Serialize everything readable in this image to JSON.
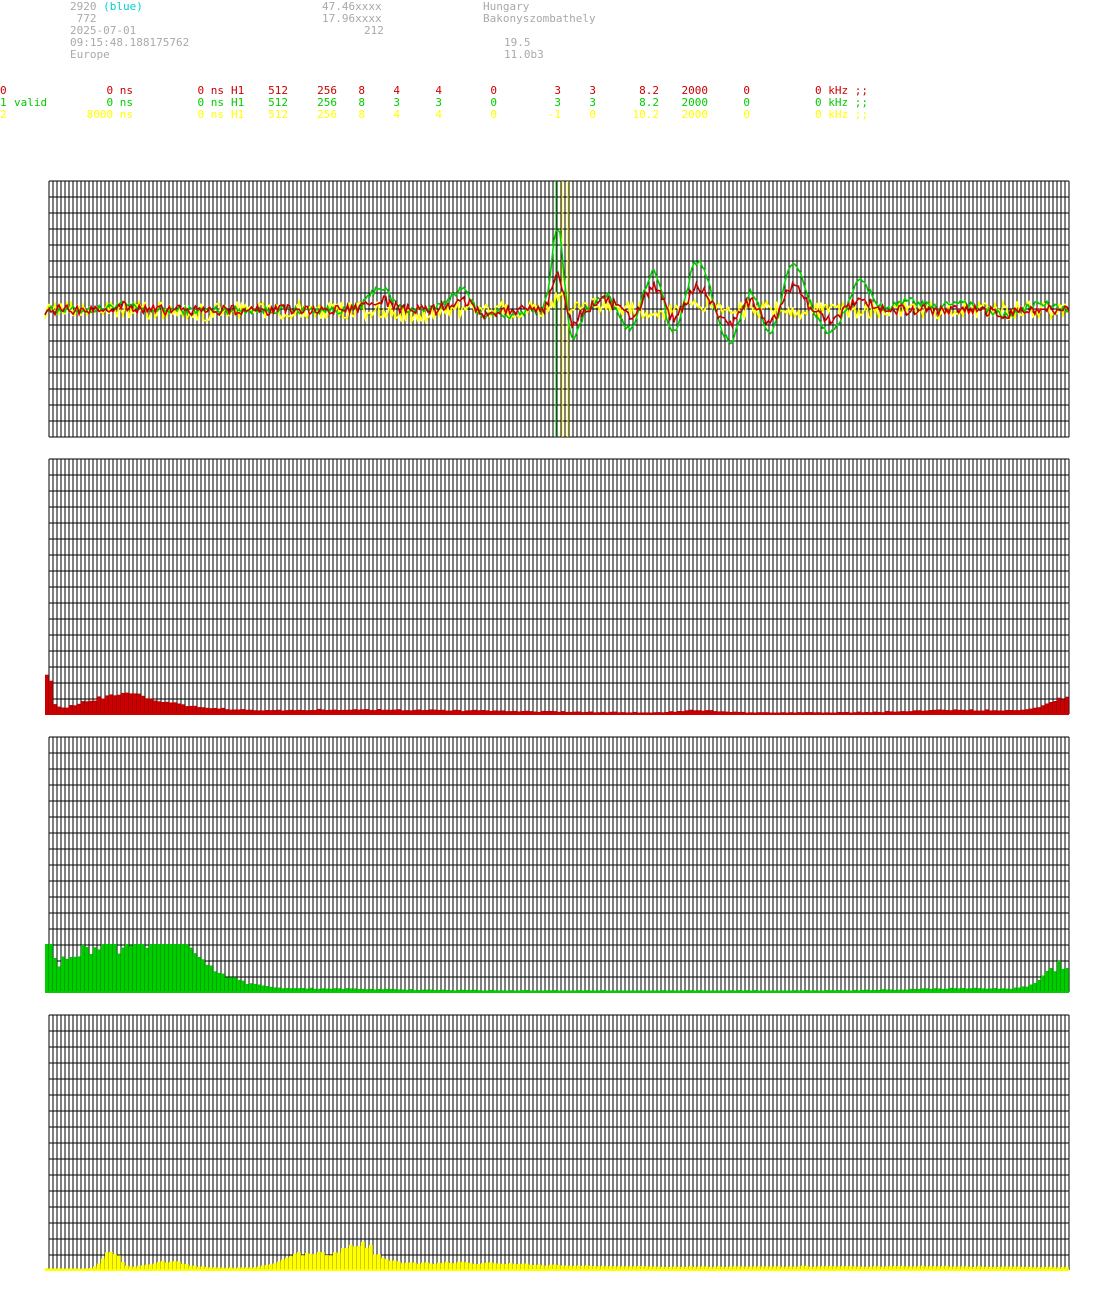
{
  "header": {
    "col1": [
      "2920",
      " 772",
      "2025-07-01",
      "09:15:48.188175762",
      "Europe"
    ],
    "col1_tag": "(blue)",
    "col2": [
      "47.46xxxx",
      "17.96xxxx",
      "212"
    ],
    "col3": [
      "Hungary",
      "Bakonyszombathely"
    ],
    "col4": [
      "19.5",
      "11.0b3"
    ]
  },
  "colors": {
    "ch0": "#cc0000",
    "ch1": "#00cc00",
    "ch2": "#ffff00",
    "grid": "#000000",
    "muted": "#a9a9a9",
    "tag": "#00d0d0"
  },
  "channels": [
    {
      "id": "0",
      "label": "",
      "delay": "0 ns",
      "offset": "0 ns",
      "filter": "H1",
      "n1": "512",
      "n2": "256",
      "n3": "8",
      "n4": "4",
      "n5": "4",
      "n6": "0",
      "n7": "3",
      "n8": "3",
      "n9": "8.2",
      "n10": "2000",
      "n11": "0",
      "freq": "0 kHz ;;"
    },
    {
      "id": "1",
      "label": "valid",
      "delay": "0 ns",
      "offset": "0 ns",
      "filter": "H1",
      "n1": "512",
      "n2": "256",
      "n3": "8",
      "n4": "3",
      "n5": "3",
      "n6": "0",
      "n7": "3",
      "n8": "3",
      "n9": "8.2",
      "n10": "2000",
      "n11": "0",
      "freq": "0 kHz ;;"
    },
    {
      "id": "2",
      "label": "",
      "delay": "8000 ns",
      "offset": "0 ns",
      "filter": "H1",
      "n1": "512",
      "n2": "256",
      "n3": "8",
      "n4": "4",
      "n5": "4",
      "n6": "0",
      "n7": "-1",
      "n8": "0",
      "n9": "10.2",
      "n10": "2000",
      "n11": "0",
      "freq": "0 kHz ;;"
    }
  ],
  "chart_data": [
    {
      "type": "line",
      "panel": "waveform",
      "x_range": [
        0,
        511
      ],
      "ylim": [
        -1,
        1
      ],
      "grid": true,
      "markers": [
        {
          "x": 255,
          "color": "#00cc00"
        },
        {
          "x": 258,
          "color": "#ffff00"
        },
        {
          "x": 261,
          "color": "#ffff00"
        }
      ],
      "series": [
        {
          "color": "#00cc00",
          "noise": 0.03,
          "features": [
            [
              38,
              6,
              0.04
            ],
            [
              167,
              5,
              0.18
            ],
            [
              208,
              6,
              0.16
            ],
            [
              218,
              4,
              -0.08
            ],
            [
              233,
              4,
              -0.05
            ],
            [
              256,
              3,
              0.66
            ],
            [
              263,
              3,
              -0.28
            ],
            [
              280,
              5,
              0.12
            ],
            [
              292,
              5,
              -0.16
            ],
            [
              304,
              5,
              0.33
            ],
            [
              313,
              4,
              -0.25
            ],
            [
              326,
              5,
              0.38
            ],
            [
              342,
              5,
              -0.26
            ],
            [
              351,
              4,
              0.18
            ],
            [
              363,
              4,
              -0.22
            ],
            [
              373,
              5,
              0.38
            ],
            [
              392,
              5,
              -0.18
            ],
            [
              407,
              5,
              0.22
            ],
            [
              432,
              6,
              0.07
            ],
            [
              456,
              6,
              0.07
            ],
            [
              480,
              6,
              -0.04
            ],
            [
              497,
              6,
              0.05
            ]
          ]
        },
        {
          "color": "#cc0000",
          "noise": 0.04,
          "features": [
            [
              38,
              6,
              0.03
            ],
            [
              167,
              5,
              0.08
            ],
            [
              208,
              6,
              0.08
            ],
            [
              218,
              4,
              -0.04
            ],
            [
              256,
              3,
              0.28
            ],
            [
              263,
              3,
              -0.12
            ],
            [
              280,
              5,
              0.08
            ],
            [
              292,
              5,
              -0.06
            ],
            [
              304,
              5,
              0.18
            ],
            [
              313,
              4,
              -0.1
            ],
            [
              326,
              5,
              0.18
            ],
            [
              342,
              5,
              -0.12
            ],
            [
              351,
              4,
              0.08
            ],
            [
              363,
              4,
              -0.12
            ],
            [
              373,
              5,
              0.18
            ],
            [
              392,
              5,
              -0.08
            ],
            [
              407,
              5,
              0.08
            ],
            [
              480,
              6,
              -0.03
            ]
          ]
        },
        {
          "color": "#ffff00",
          "noise": 0.07,
          "features": [
            [
              70,
              8,
              -0.03
            ],
            [
              185,
              6,
              -0.05
            ],
            [
              256,
              3,
              0.1
            ],
            [
              275,
              5,
              0.06
            ],
            [
              330,
              5,
              0.06
            ]
          ]
        }
      ]
    },
    {
      "type": "bar",
      "panel": "spectrum-0",
      "color": "#cc0000",
      "bins": 256,
      "ylim": [
        0,
        1
      ],
      "peaks": [
        [
          0,
          1,
          0.95
        ],
        [
          13,
          8,
          0.22
        ],
        [
          20,
          5,
          0.25
        ],
        [
          30,
          5,
          0.15
        ],
        [
          40,
          6,
          0.06
        ],
        [
          60,
          25,
          0.03
        ],
        [
          90,
          30,
          0.05
        ],
        [
          163,
          5,
          0.05
        ],
        [
          255,
          5,
          0.3
        ],
        [
          230,
          15,
          0.06
        ]
      ]
    },
    {
      "type": "bar",
      "panel": "spectrum-1",
      "color": "#00cc00",
      "bins": 256,
      "ylim": [
        0,
        1
      ],
      "peaks": [
        [
          0,
          1,
          1.0
        ],
        [
          15,
          12,
          1.0
        ],
        [
          32,
          5,
          0.7
        ],
        [
          40,
          8,
          0.25
        ],
        [
          60,
          25,
          0.05
        ],
        [
          255,
          5,
          0.6
        ],
        [
          230,
          15,
          0.05
        ]
      ]
    },
    {
      "type": "bar",
      "panel": "spectrum-2",
      "color": "#ffff00",
      "bins": 256,
      "ylim": [
        0,
        1
      ],
      "peaks": [
        [
          16,
          2,
          0.4
        ],
        [
          30,
          5,
          0.15
        ],
        [
          65,
          5,
          0.3
        ],
        [
          78,
          4,
          0.45
        ],
        [
          95,
          25,
          0.12
        ],
        [
          200,
          60,
          0.05
        ]
      ]
    }
  ]
}
